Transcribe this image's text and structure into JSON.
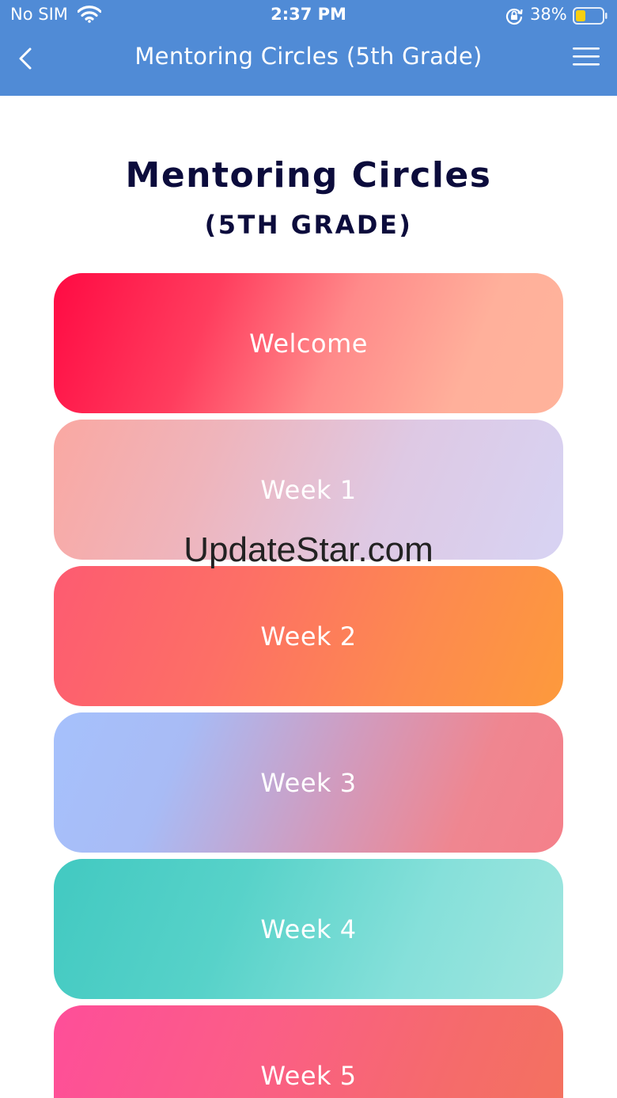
{
  "status_bar": {
    "carrier": "No SIM",
    "time": "2:37 PM",
    "battery": "38%"
  },
  "nav": {
    "title": "Mentoring Circles (5th Grade)",
    "back_icon": "chevron-left-icon",
    "menu_icon": "hamburger-menu-icon"
  },
  "page": {
    "title": "Mentoring Circles",
    "subtitle": "(5TH GRADE)"
  },
  "cards": [
    {
      "label": "Welcome"
    },
    {
      "label": "Week 1"
    },
    {
      "label": "Week 2"
    },
    {
      "label": "Week 3"
    },
    {
      "label": "Week 4"
    },
    {
      "label": "Week 5"
    }
  ],
  "watermark": "UpdateStar.com",
  "colors": {
    "header": "#508bd6",
    "title": "#0c0c3c",
    "battery_fill": "#f7cf12"
  }
}
